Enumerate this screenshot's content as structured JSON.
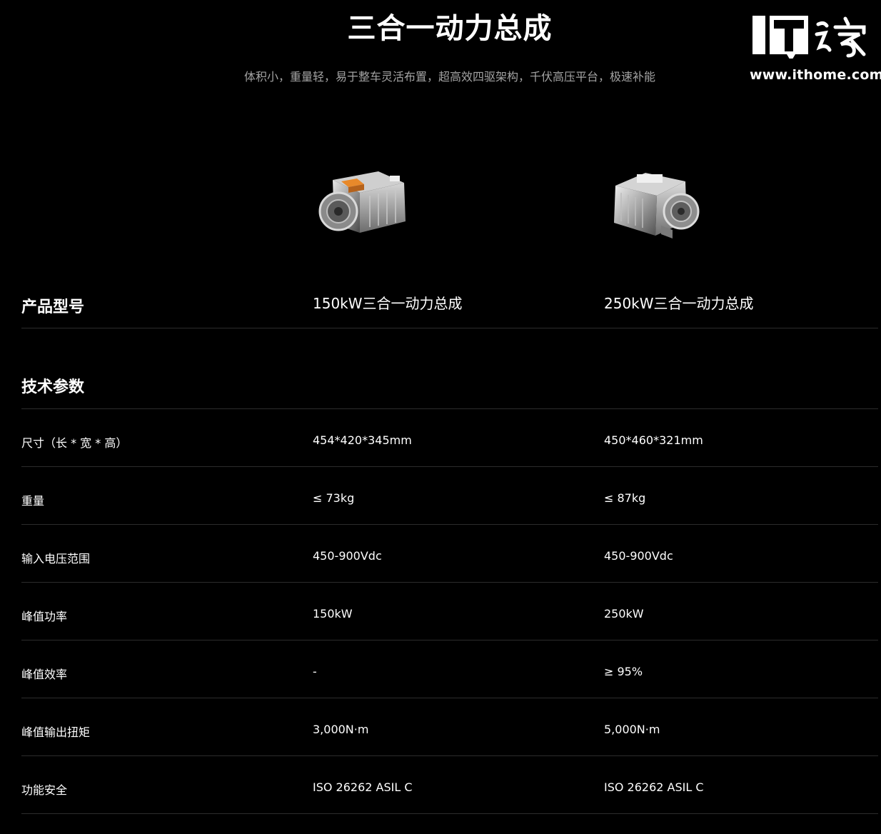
{
  "header": {
    "title": "三合一动力总成",
    "subtitle": "体积小，重量轻，易于整车灵活布置，超高效四驱架构，千伏高压平台，极速补能"
  },
  "watermark": {
    "logo_text": "IT之家",
    "url": "www.ithome.com"
  },
  "products": {
    "images": [
      {
        "icon": "powertrain-150kw-image"
      },
      {
        "icon": "powertrain-250kw-image"
      }
    ],
    "model_label": "产品型号",
    "models": [
      "150kW三合一动力总成",
      "250kW三合一动力总成"
    ]
  },
  "specs": {
    "section_title": "技术参数",
    "rows": [
      {
        "label": "尺寸（长 * 宽 * 高）",
        "values": [
          "454*420*345mm",
          "450*460*321mm"
        ]
      },
      {
        "label": "重量",
        "values": [
          "≤ 73kg",
          "≤ 87kg"
        ]
      },
      {
        "label": "输入电压范围",
        "values": [
          "450-900Vdc",
          "450-900Vdc"
        ]
      },
      {
        "label": "峰值功率",
        "values": [
          "150kW",
          "250kW"
        ]
      },
      {
        "label": "峰值效率",
        "values": [
          "-",
          "≥ 95%"
        ]
      },
      {
        "label": "峰值输出扭矩",
        "values": [
          "3,000N·m",
          "5,000N·m"
        ]
      },
      {
        "label": "功能安全",
        "values": [
          "ISO 26262 ASIL C",
          "ISO 26262 ASIL C"
        ]
      }
    ]
  },
  "colors": {
    "background": "#000000",
    "text": "#ffffff",
    "subtitle": "#a3a3a3",
    "divider": "#2c2c2c",
    "accent_orange": "#e8892a"
  }
}
